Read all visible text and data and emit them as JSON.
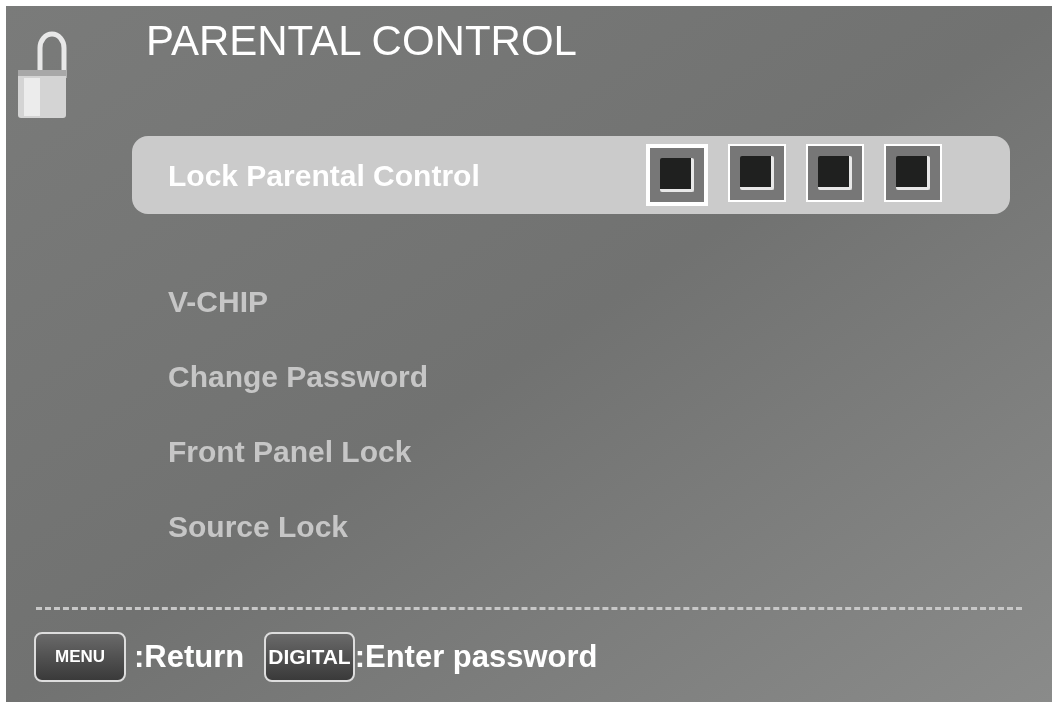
{
  "title": "PARENTAL CONTROL",
  "menu_items": [
    {
      "label": "Lock Parental Control",
      "selected": true,
      "kind": "password"
    },
    {
      "label": "V-CHIP",
      "selected": false,
      "kind": "plain"
    },
    {
      "label": "Change Password",
      "selected": false,
      "kind": "plain"
    },
    {
      "label": "Front Panel Lock",
      "selected": false,
      "kind": "plain"
    },
    {
      "label": "Source Lock",
      "selected": false,
      "kind": "plain"
    }
  ],
  "password_slots": [
    {
      "selected": true
    },
    {
      "selected": false
    },
    {
      "selected": false
    },
    {
      "selected": false
    }
  ],
  "hints": [
    {
      "key": "MENU",
      "action": ":Return"
    },
    {
      "key": "DIGITAL",
      "action": ":Enter password"
    }
  ]
}
